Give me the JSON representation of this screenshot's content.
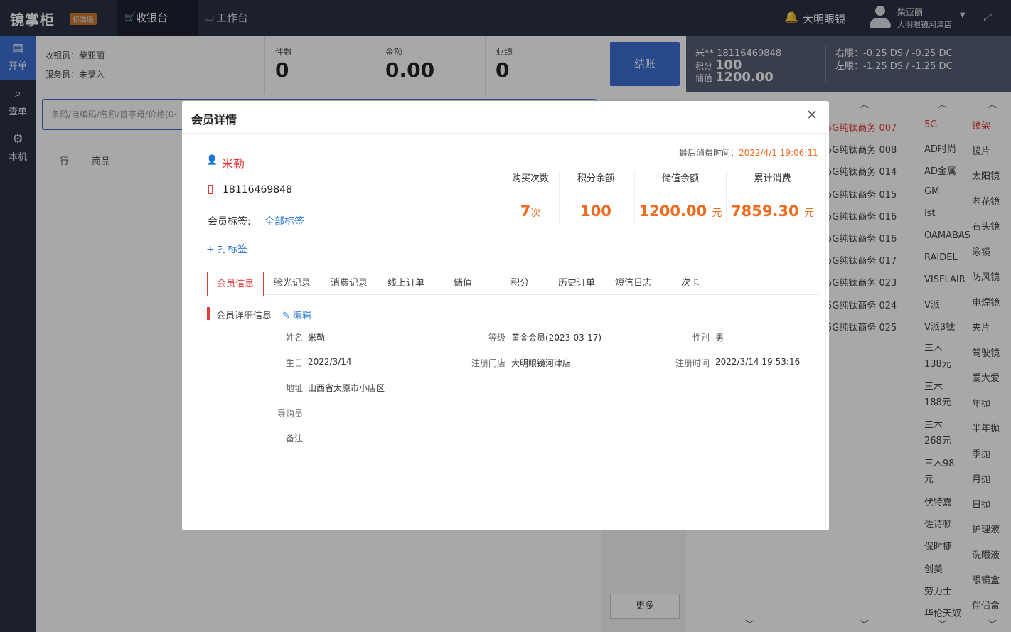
{
  "app": {
    "name": "镜掌柜",
    "edition": "标准版"
  },
  "nav": {
    "tabs": [
      {
        "label": "收银台",
        "icon": "cart-icon",
        "active": true
      },
      {
        "label": "工作台",
        "icon": "monitor-icon",
        "active": false
      }
    ]
  },
  "header": {
    "store_name": "大明眼镜",
    "user_name": "柴亚丽",
    "user_store": "大明眼镜河津店"
  },
  "sidebar": {
    "items": [
      {
        "label": "开单",
        "icon": "list-icon",
        "active": true
      },
      {
        "label": "查单",
        "icon": "search-icon",
        "active": false
      },
      {
        "label": "本机",
        "icon": "gear-icon",
        "active": false
      }
    ]
  },
  "cashier": {
    "cashier_label": "收银员：柴亚丽",
    "staff_label": "服务员：未录入",
    "stats": [
      {
        "label": "件数",
        "value": "0"
      },
      {
        "label": "金额",
        "value": "0.00"
      },
      {
        "label": "业绩",
        "value": "0"
      }
    ],
    "checkout_label": "结账",
    "search_placeholder": "条码/自编码/名称/首字母/价格(0-",
    "col_row": "行",
    "col_product": "商品",
    "more_label": "更多"
  },
  "member_panel": {
    "phone_masked": "米** 18116469848",
    "points_label": "积分",
    "points": "100",
    "balance_label": "储值",
    "balance": "1200.00",
    "right_eye": "右眼：-0.25 DS / -0.25 DC",
    "left_eye": "左眼：-1.25 DS / -1.25 DC"
  },
  "products": [
    "5G纯钛商务 007",
    "5G纯钛商务 008",
    "5G纯钛商务 014",
    "5G纯钛商务 015",
    "5G纯钛商务 016",
    "5G纯钛商务 016",
    "5G纯钛商务 017",
    "5G纯钛商务 023",
    "5G纯钛商务 024",
    "5G纯钛商务 025"
  ],
  "brands": [
    "5G",
    "AD时尚",
    "AD金属",
    "GM",
    "ist",
    "OAMABAS",
    "RAIDEL",
    "VISFLAIR",
    "V派",
    "V派β钛",
    "三木138元",
    "三木188元",
    "三木268元",
    "三木98元",
    "伏特嘉",
    "佐诗顿",
    "保时捷",
    "创美",
    "劳力士",
    "华伦天奴"
  ],
  "categories": [
    "镜架",
    "镜片",
    "太阳镜",
    "老花镜",
    "石头镜",
    "泳镜",
    "防风镜",
    "电焊镜",
    "夹片",
    "驾驶镜",
    "爱大爱",
    "年抛",
    "半年抛",
    "季抛",
    "月抛",
    "日抛",
    "护理液",
    "洗眼液",
    "眼镜盒",
    "伴侣盒"
  ],
  "modal": {
    "title": "会员详情",
    "name": "米勒",
    "phone": "18116469848",
    "tags_label": "会员标签:",
    "tags_value": "全部标签",
    "add_tag": "+ 打标签",
    "last_visit_label": "最后消费时间：",
    "last_visit": "2022/4/1 19:06:11",
    "stats": [
      {
        "label": "购买次数",
        "value": "7",
        "unit": "次"
      },
      {
        "label": "积分余额",
        "value": "100",
        "unit": ""
      },
      {
        "label": "储值余额",
        "value": "1200.00",
        "unit": "元"
      },
      {
        "label": "累计消费",
        "value": "7859.30",
        "unit": "元"
      }
    ],
    "tabs": [
      "会员信息",
      "验光记录",
      "消费记录",
      "线上订单",
      "储值",
      "积分",
      "历史订单",
      "短信日志",
      "次卡"
    ],
    "section_title": "会员详细信息",
    "edit_label": "编辑",
    "fields": {
      "name": {
        "k": "姓名",
        "v": "米勒"
      },
      "level": {
        "k": "等级",
        "v": "黄金会员(2023-03-17)"
      },
      "gender": {
        "k": "性别",
        "v": "男"
      },
      "birthday": {
        "k": "生日",
        "v": "2022/3/14"
      },
      "reg_store": {
        "k": "注册门店",
        "v": "大明眼镜河津店"
      },
      "reg_time": {
        "k": "注册时间",
        "v": "2022/3/14 19:53:16"
      },
      "address": {
        "k": "地址",
        "v": "山西省太原市小店区"
      },
      "guide": {
        "k": "导购员",
        "v": ""
      },
      "remark": {
        "k": "备注",
        "v": ""
      }
    }
  }
}
